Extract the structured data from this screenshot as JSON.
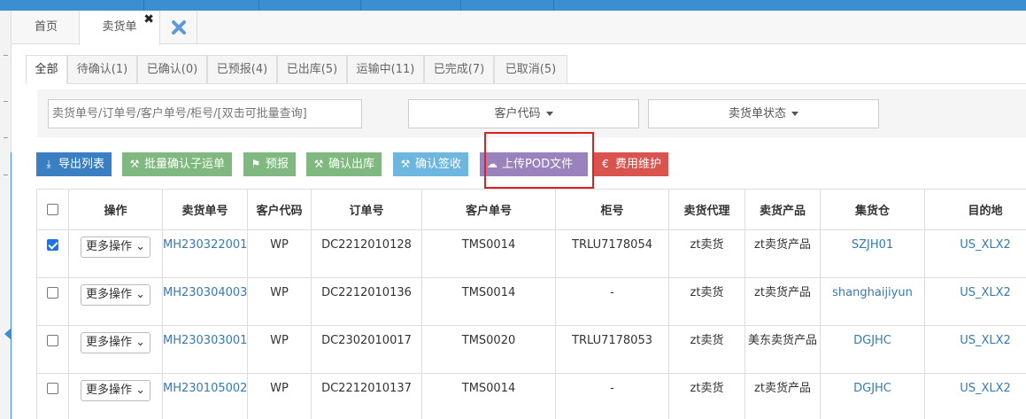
{
  "page_tabs": {
    "home": "首页",
    "active": "卖货单",
    "active_close": "✖"
  },
  "status_tabs": [
    {
      "label": "全部",
      "active": true
    },
    {
      "label": "待确认(1)"
    },
    {
      "label": "已确认(0)"
    },
    {
      "label": "已预报(4)"
    },
    {
      "label": "已出库(5)"
    },
    {
      "label": "运输中(11)"
    },
    {
      "label": "已完成(7)"
    },
    {
      "label": "已取消(5)"
    }
  ],
  "filters": {
    "search_placeholder": "卖货单号/订单号/客户单号/柜号/[双击可批量查询]",
    "customer_code": "客户代码",
    "order_status": "卖货单状态"
  },
  "toolbar": [
    {
      "label": "导出列表",
      "icon": "download-icon",
      "color": "#3a7fc1"
    },
    {
      "label": "批量确认子运单",
      "icon": "gavel-icon",
      "color": "#7fb97f"
    },
    {
      "label": "预报",
      "icon": "flag-icon",
      "color": "#7fb97f"
    },
    {
      "label": "确认出库",
      "icon": "gavel-icon",
      "color": "#7fb97f"
    },
    {
      "label": "确认签收",
      "icon": "gavel-icon",
      "color": "#6cb6df"
    },
    {
      "label": "上传POD文件",
      "icon": "cloud-upload-icon",
      "color": "#9a82bd"
    },
    {
      "label": "费用维护",
      "icon": "euro-icon",
      "color": "#d9534f"
    }
  ],
  "table": {
    "headers": [
      "操作",
      "卖货单号",
      "客户代码",
      "订单号",
      "客户单号",
      "柜号",
      "卖货代理",
      "卖货产品",
      "集货仓",
      "目的地"
    ],
    "action_label": "更多操作",
    "rows": [
      {
        "checked": true,
        "order_no": "MH230322001",
        "customer": "WP",
        "order": "DC2212010128",
        "cust_no": "TMS0014",
        "container": "TRLU7178054",
        "agent": "zt卖货",
        "product": "zt卖货产品",
        "warehouse": "SZJH01",
        "dest": "US_XLX2"
      },
      {
        "checked": false,
        "order_no": "MH230304003",
        "customer": "WP",
        "order": "DC2212010136",
        "cust_no": "TMS0014",
        "container": "-",
        "agent": "zt卖货",
        "product": "zt卖货产品",
        "warehouse": "shanghaijiyun",
        "dest": "US_XLX2"
      },
      {
        "checked": false,
        "order_no": "MH230303001",
        "customer": "WP",
        "order": "DC2302010017",
        "cust_no": "TMS0020",
        "container": "TRLU7178053",
        "agent": "zt卖货",
        "product": "美东卖货产品",
        "warehouse": "DGJHC",
        "dest": "US_XLX2"
      },
      {
        "checked": false,
        "order_no": "MH230105002",
        "customer": "WP",
        "order": "DC2212010137",
        "cust_no": "TMS0014",
        "container": "-",
        "agent": "zt卖货",
        "product": "zt卖货产品",
        "warehouse": "DGJHC",
        "dest": "US_XLX2"
      }
    ]
  },
  "colors": {
    "accent": "#3b8fd0",
    "link": "#337ab7",
    "highlight_border": "#e02020"
  }
}
